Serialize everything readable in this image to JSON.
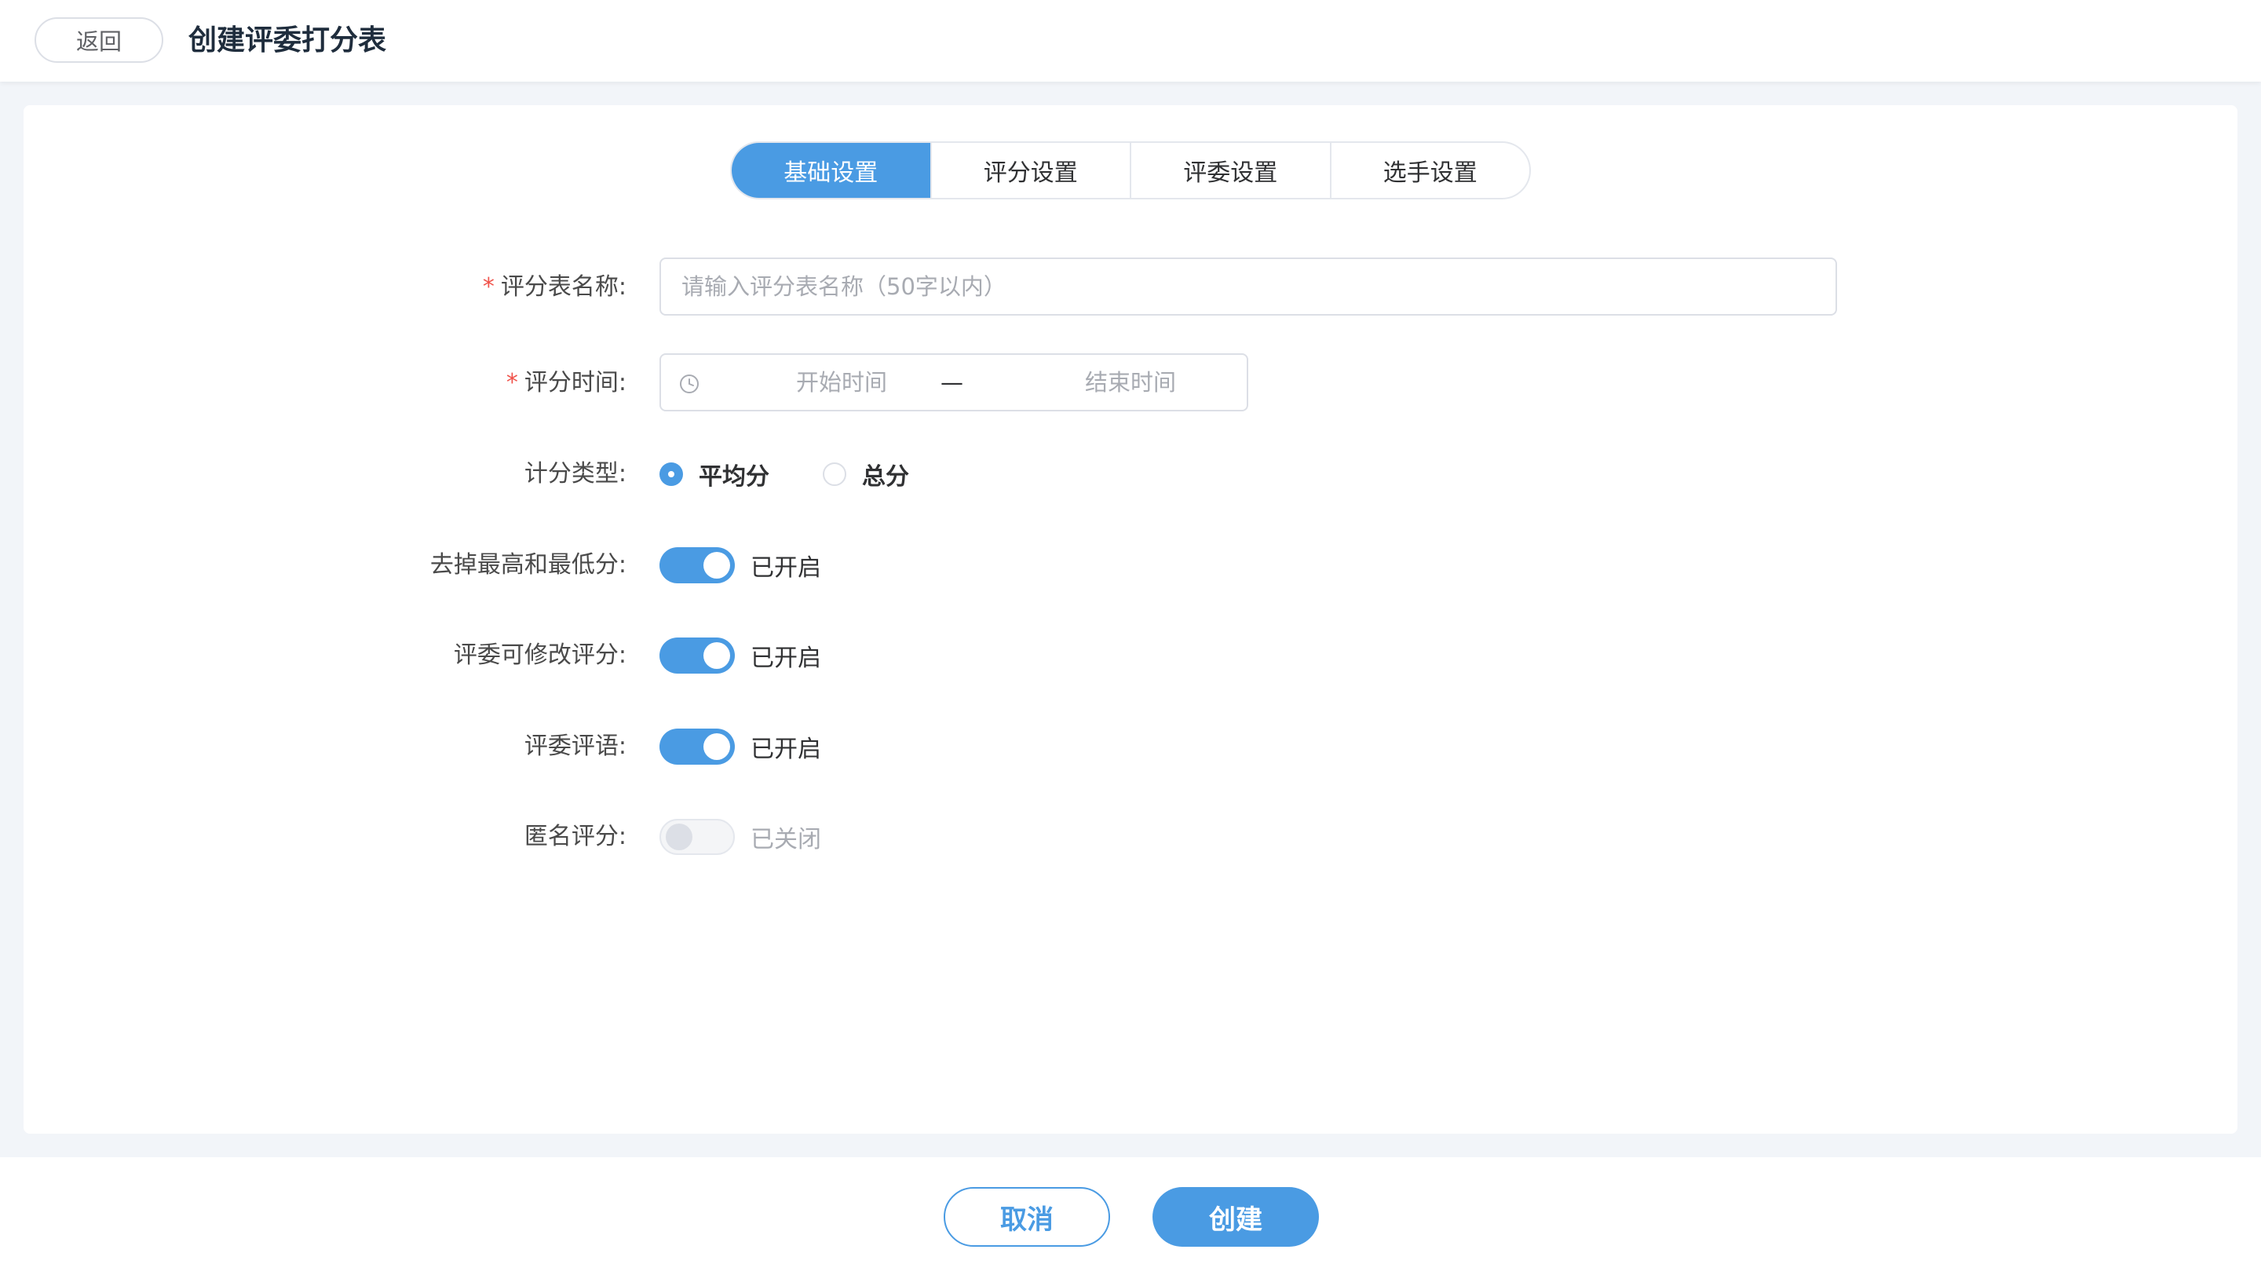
{
  "header": {
    "back_label": "返回",
    "title": "创建评委打分表"
  },
  "tabs": [
    {
      "label": "基础设置",
      "active": true
    },
    {
      "label": "评分设置",
      "active": false
    },
    {
      "label": "评委设置",
      "active": false
    },
    {
      "label": "选手设置",
      "active": false
    }
  ],
  "form": {
    "name": {
      "required_mark": "*",
      "label": "评分表名称:",
      "value": "",
      "placeholder": "请输入评分表名称（50字以内）"
    },
    "time": {
      "required_mark": "*",
      "label": "评分时间:",
      "icon": "clock-icon",
      "start_placeholder": "开始时间",
      "separator": "—",
      "end_placeholder": "结束时间"
    },
    "score_type": {
      "label": "计分类型:",
      "options": [
        "平均分",
        "总分"
      ],
      "selected": "平均分"
    },
    "drop_extremes": {
      "label": "去掉最高和最低分:",
      "enabled": true,
      "status_text": "已开启"
    },
    "judge_can_modify": {
      "label": "评委可修改评分:",
      "enabled": true,
      "status_text": "已开启"
    },
    "judge_comments": {
      "label": "评委评语:",
      "enabled": true,
      "status_text": "已开启"
    },
    "anonymous": {
      "label": "匿名评分:",
      "enabled": false,
      "status_text": "已关闭"
    }
  },
  "footer": {
    "cancel_label": "取消",
    "create_label": "创建"
  },
  "colors": {
    "accent": "#4a9be3",
    "required": "#f0524a",
    "background": "#f2f5f9"
  }
}
